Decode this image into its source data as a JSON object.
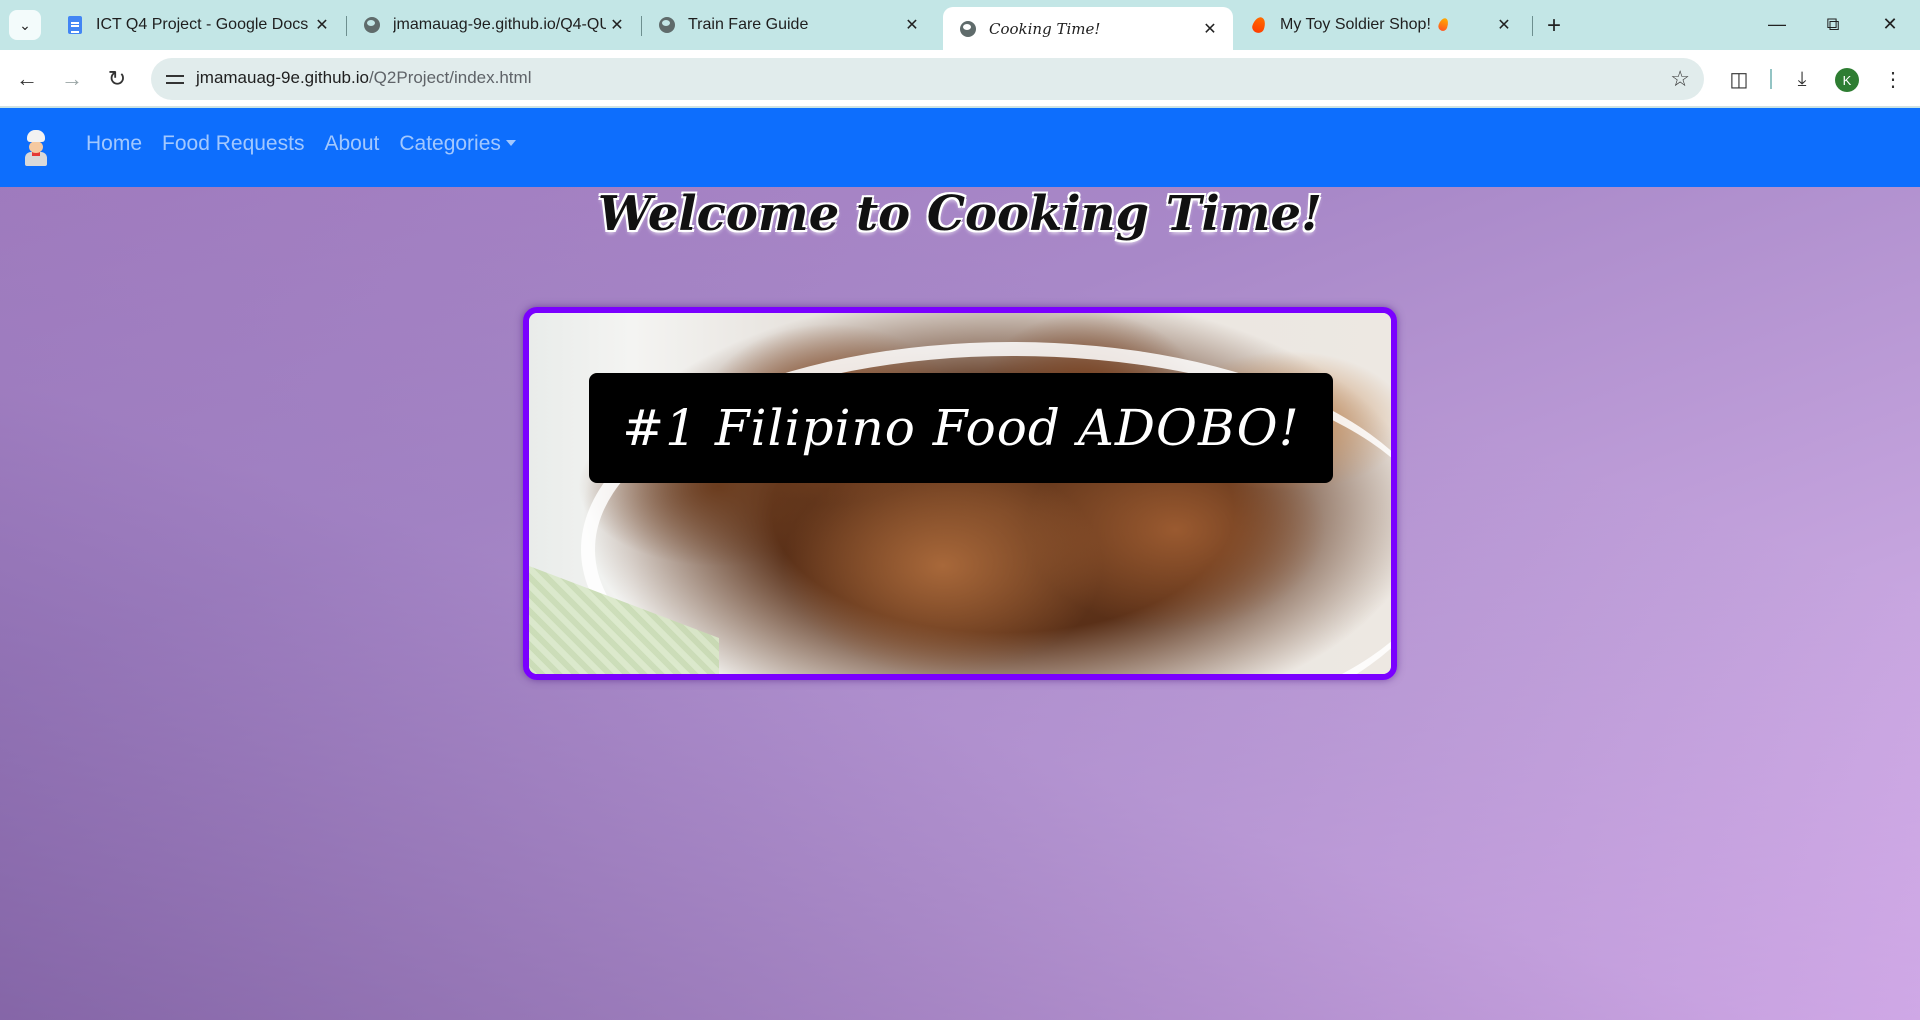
{
  "browser": {
    "tabs": [
      {
        "title": "ICT Q4 Project - Google Docs",
        "icon": "google-docs-icon",
        "active": false
      },
      {
        "title": "jmamauag-9e.github.io/Q4-QU",
        "icon": "globe-icon",
        "active": false
      },
      {
        "title": "Train Fare Guide",
        "icon": "globe-icon",
        "active": false
      },
      {
        "title": "Cooking Time!",
        "icon": "globe-icon",
        "active": true
      },
      {
        "title": "My Toy Soldier Shop!",
        "icon": "fire-icon",
        "active": false
      }
    ],
    "url": {
      "domain": "jmamauag-9e.github.io",
      "path": "/Q2Project/index.html"
    },
    "profile_initial": "K"
  },
  "site": {
    "nav": {
      "items": [
        "Home",
        "Food Requests",
        "About",
        "Categories"
      ]
    },
    "heading": "Welcome to Cooking Time!",
    "hero": {
      "caption": "#1 Filipino Food ADOBO!"
    }
  },
  "colors": {
    "navbar": "#0d6efd",
    "hero_border": "#7a00ff",
    "tabstrip": "#c3e6e6"
  }
}
